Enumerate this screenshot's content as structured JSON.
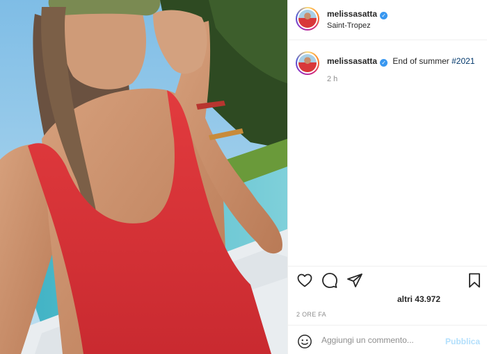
{
  "post": {
    "username": "melissasatta",
    "location": "Saint-Tropez",
    "caption_text": "End of summer",
    "caption_hashtag": "#2021",
    "caption_time": "2 h",
    "likes_label": "altri 43.972",
    "timestamp": "2 ORE FA"
  },
  "comment": {
    "placeholder": "Aggiungi un commento...",
    "publish_label": "Pubblica"
  },
  "colors": {
    "accent_blue": "#3897f0",
    "publish_disabled": "#b2dffc",
    "hashtag": "#00376b",
    "swimsuit_red": "#d8373a"
  },
  "icons": [
    "heart-icon",
    "comment-icon",
    "share-icon",
    "bookmark-icon",
    "emoji-icon",
    "verified-icon"
  ]
}
